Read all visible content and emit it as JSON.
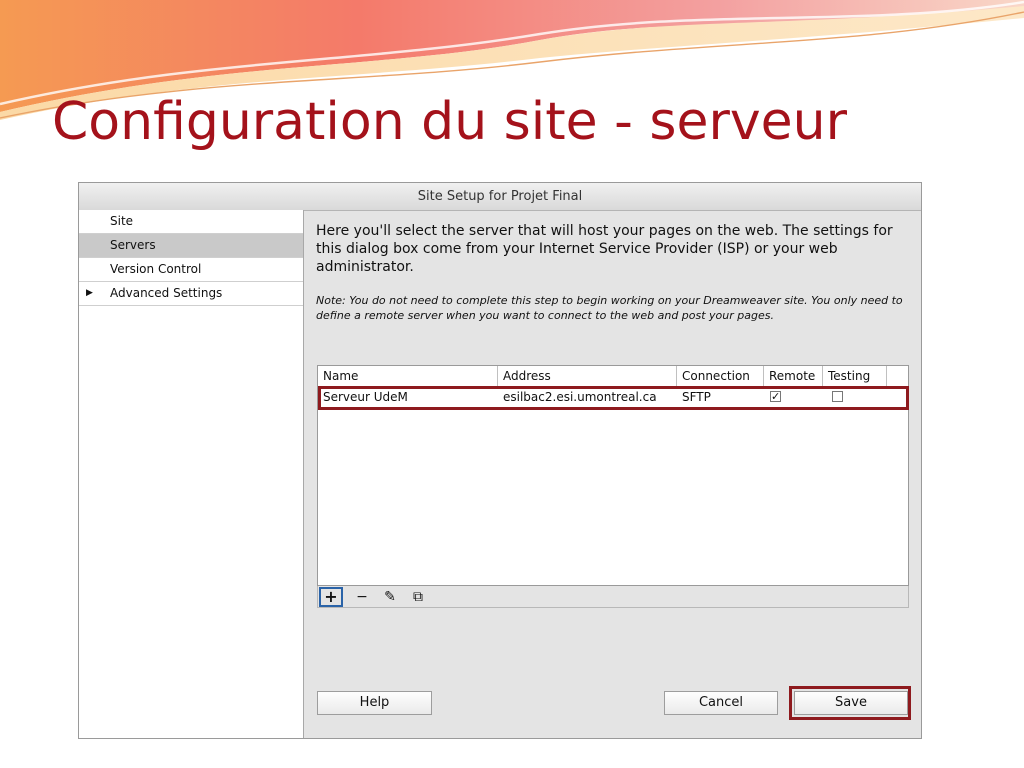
{
  "slide": {
    "title": "Configuration du site - serveur",
    "accent_color": "#a4121b",
    "deco_colors": [
      "#f2766c",
      "#f7b27a",
      "#fad6a8"
    ]
  },
  "dialog": {
    "title": "Site Setup for Projet Final",
    "sidebar": {
      "items": [
        {
          "label": "Site",
          "selected": false,
          "expandable": false
        },
        {
          "label": "Servers",
          "selected": true,
          "expandable": false
        },
        {
          "label": "Version Control",
          "selected": false,
          "expandable": false
        },
        {
          "label": "Advanced Settings",
          "selected": false,
          "expandable": true,
          "arrow": "▶"
        }
      ]
    },
    "intro": "Here you'll select the server that will host your pages on the web. The settings for this dialog box come from your Internet Service Provider (ISP) or your web administrator.",
    "note": "Note: You do not need to complete this step to begin working on your Dreamweaver site. You only need to define a remote server when you want to connect to the web and post your pages.",
    "table": {
      "columns": [
        "Name",
        "Address",
        "Connection",
        "Remote",
        "Testing"
      ],
      "rows": [
        {
          "name": "Serveur UdeM",
          "address": "esilbac2.esi.umontreal.ca",
          "connection": "SFTP",
          "remote": true,
          "testing": false,
          "remote_mark": "✓",
          "testing_mark": ""
        }
      ]
    },
    "toolbar": {
      "add": "+",
      "remove": "−",
      "edit": "✎",
      "duplicate": "⧉"
    },
    "buttons": {
      "help": "Help",
      "cancel": "Cancel",
      "save": "Save"
    },
    "highlight_color": "#8e1a1e"
  }
}
